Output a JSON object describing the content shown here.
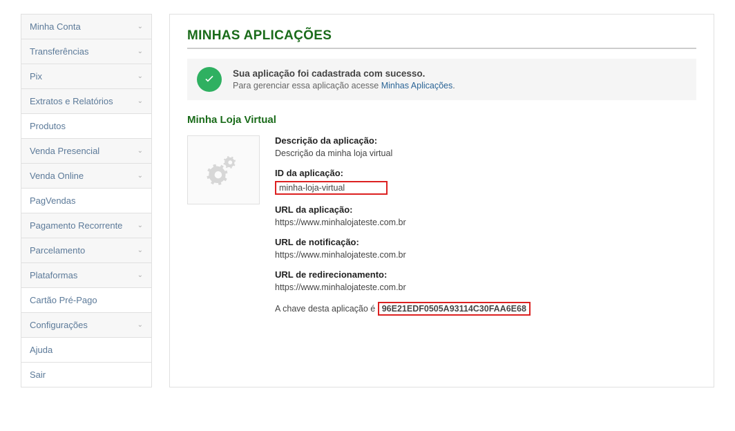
{
  "sidebar": {
    "items": [
      {
        "label": "Minha Conta",
        "expandable": true
      },
      {
        "label": "Transferências",
        "expandable": true
      },
      {
        "label": "Pix",
        "expandable": true
      },
      {
        "label": "Extratos e Relatórios",
        "expandable": true
      },
      {
        "label": "Produtos",
        "expandable": false
      },
      {
        "label": "Venda Presencial",
        "expandable": true
      },
      {
        "label": "Venda Online",
        "expandable": true
      },
      {
        "label": "PagVendas",
        "expandable": false
      },
      {
        "label": "Pagamento Recorrente",
        "expandable": true
      },
      {
        "label": "Parcelamento",
        "expandable": true
      },
      {
        "label": "Plataformas",
        "expandable": true
      },
      {
        "label": "Cartão Pré-Pago",
        "expandable": false
      },
      {
        "label": "Configurações",
        "expandable": true
      },
      {
        "label": "Ajuda",
        "expandable": false
      },
      {
        "label": "Sair",
        "expandable": false
      }
    ]
  },
  "page": {
    "title": "MINHAS APLICAÇÕES"
  },
  "alert": {
    "title": "Sua aplicação foi cadastrada com sucesso.",
    "desc_prefix": "Para gerenciar essa aplicação acesse ",
    "link_text": "Minhas Aplicações",
    "desc_suffix": "."
  },
  "app": {
    "name": "Minha Loja Virtual",
    "description_label": "Descrição da aplicação:",
    "description_value": "Descrição da minha loja virtual",
    "id_label": "ID da aplicação:",
    "id_value": "minha-loja-virtual",
    "url_label": "URL da aplicação:",
    "url_value": "https://www.minhalojateste.com.br",
    "notif_label": "URL de notificação:",
    "notif_value": "https://www.minhalojateste.com.br",
    "redir_label": "URL de redirecionamento:",
    "redir_value": "https://www.minhalojateste.com.br",
    "key_prefix": "A chave desta aplicação é ",
    "key_value": "96E21EDF0505A93114C30FAA6E68"
  }
}
